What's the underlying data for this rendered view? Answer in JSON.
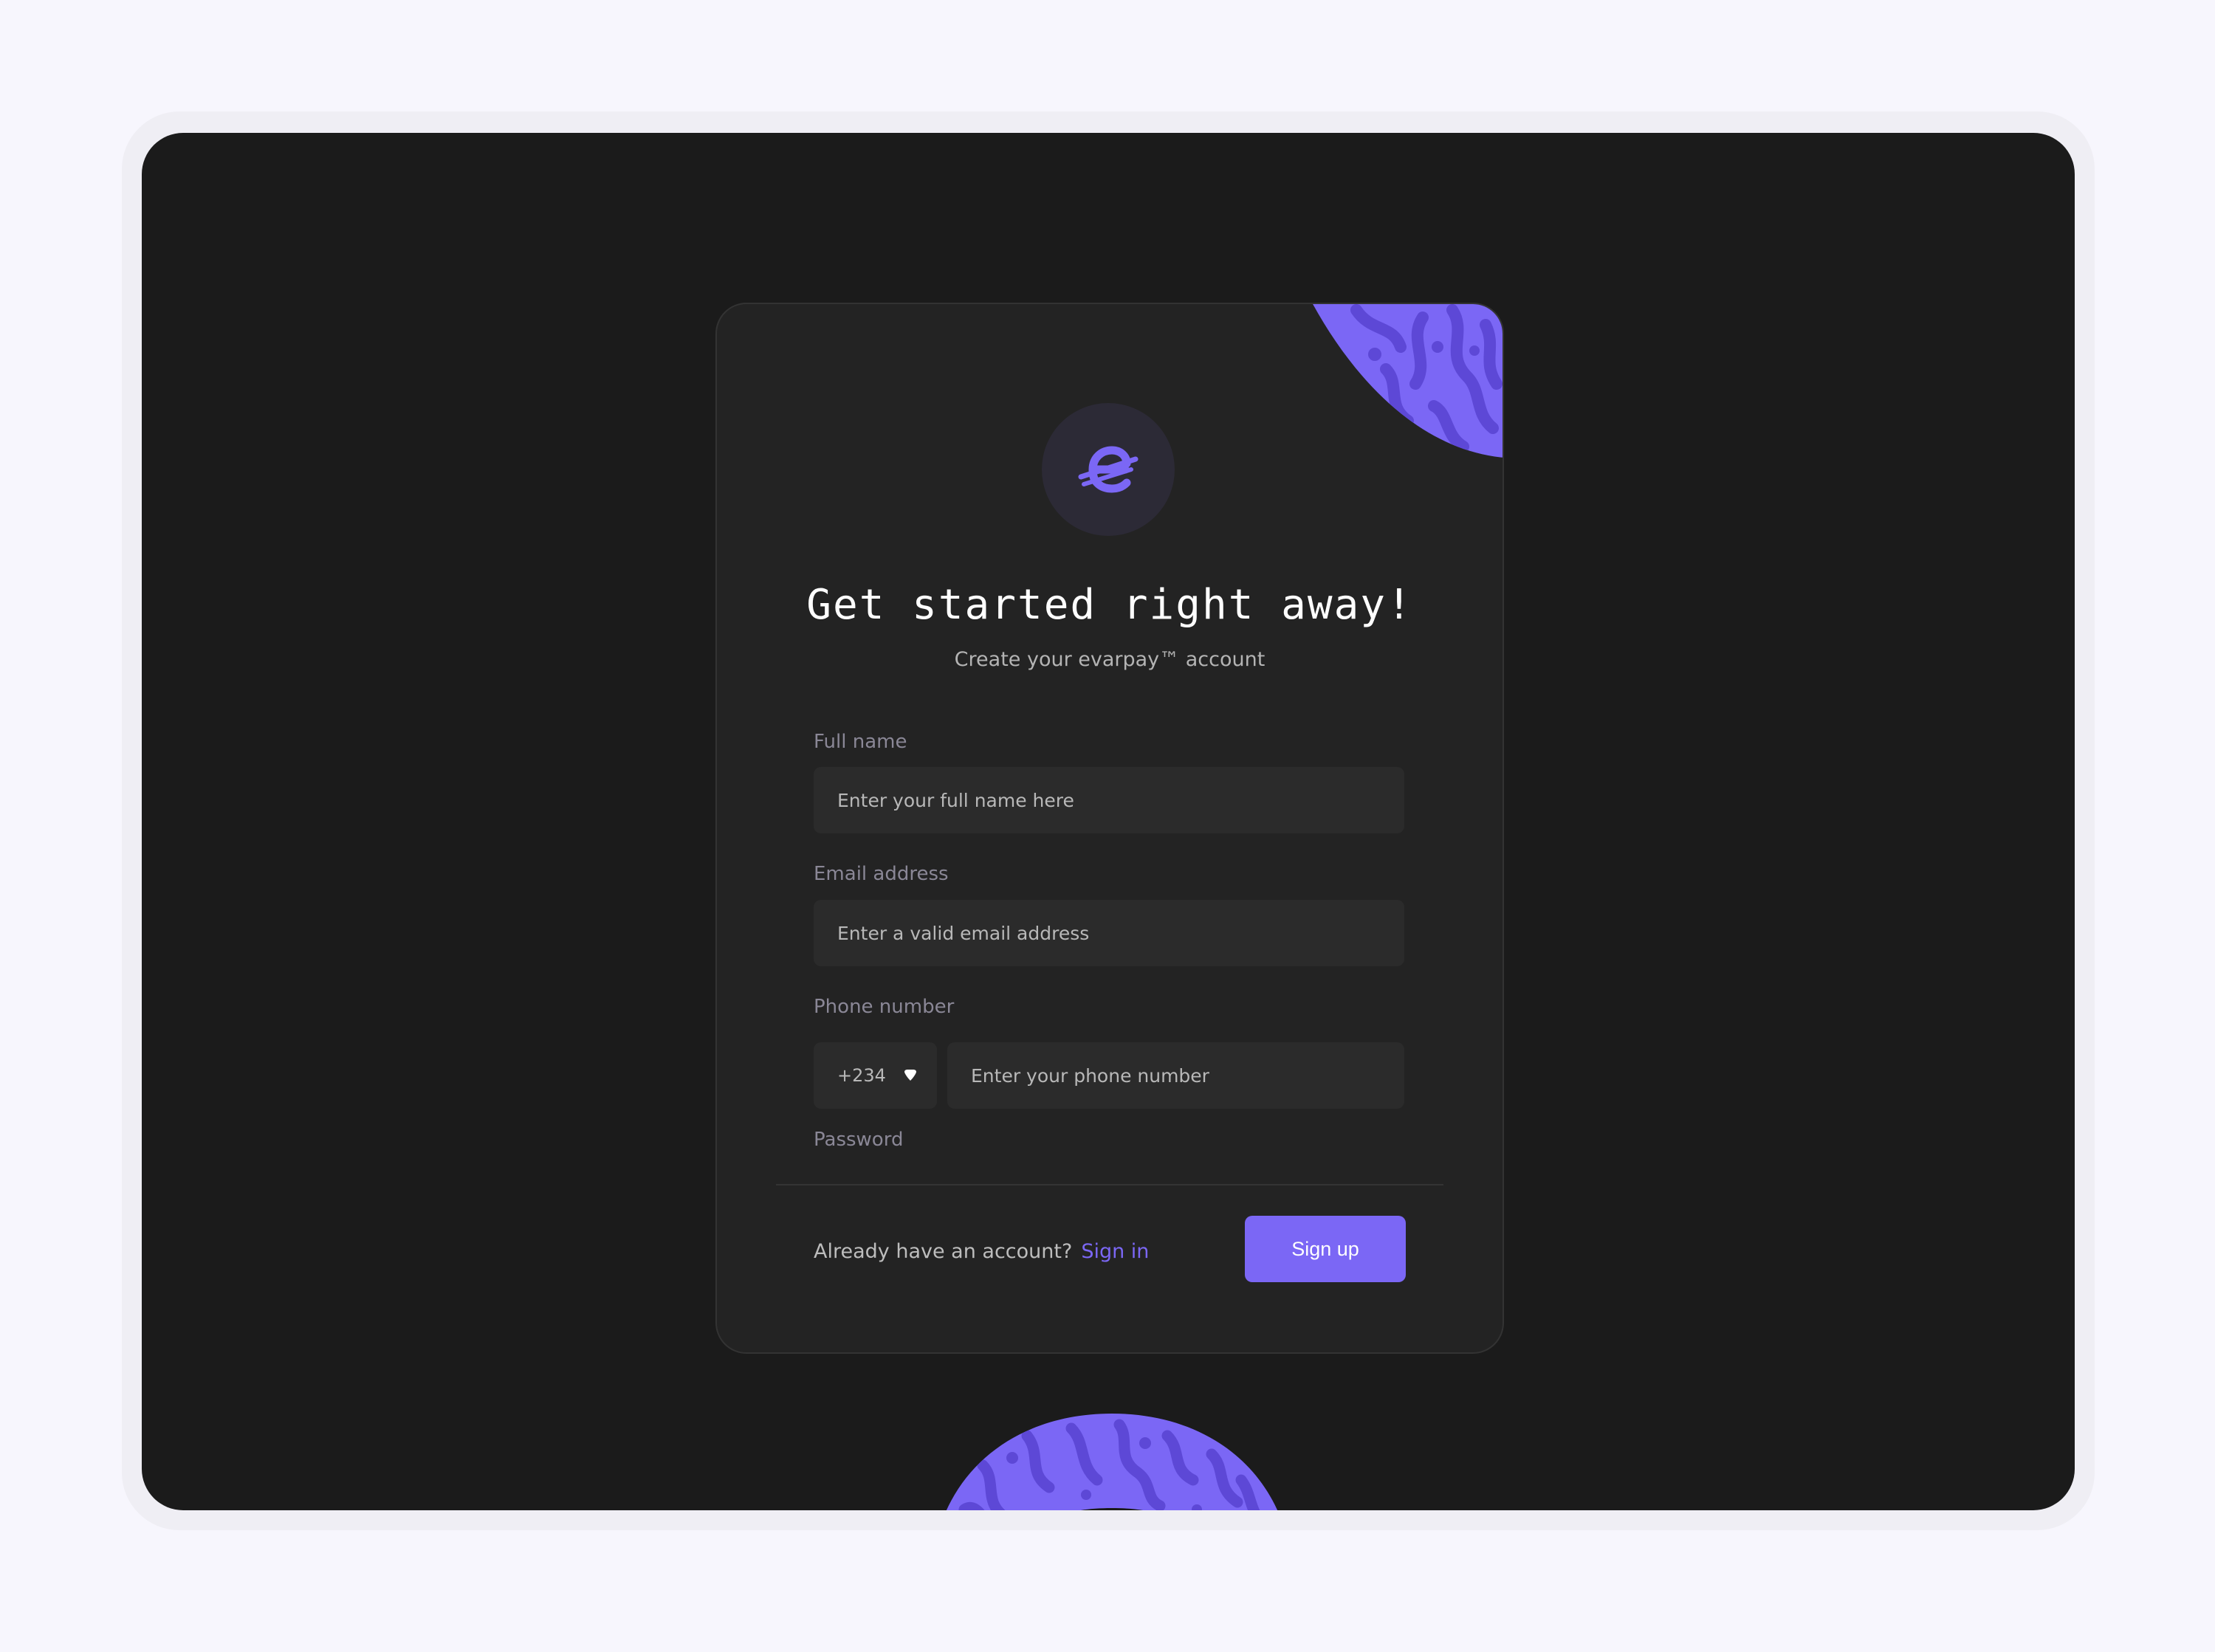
{
  "app": {
    "brand_icon": "evarpay-e-icon",
    "accent_color": "#7b67f5"
  },
  "header": {
    "title": "Get started right away!",
    "subtitle": "Create your evarpay™ account"
  },
  "form": {
    "full_name": {
      "label": "Full name",
      "placeholder": "Enter your full name here"
    },
    "email": {
      "label": "Email address",
      "placeholder": "Enter a valid email address"
    },
    "phone": {
      "label": "Phone number",
      "country_code": "+234",
      "placeholder": "Enter your phone number"
    },
    "password": {
      "label": "Password"
    }
  },
  "footer": {
    "prompt": "Already have an account?",
    "signin_label": "Sign in",
    "signup_label": "Sign up"
  }
}
